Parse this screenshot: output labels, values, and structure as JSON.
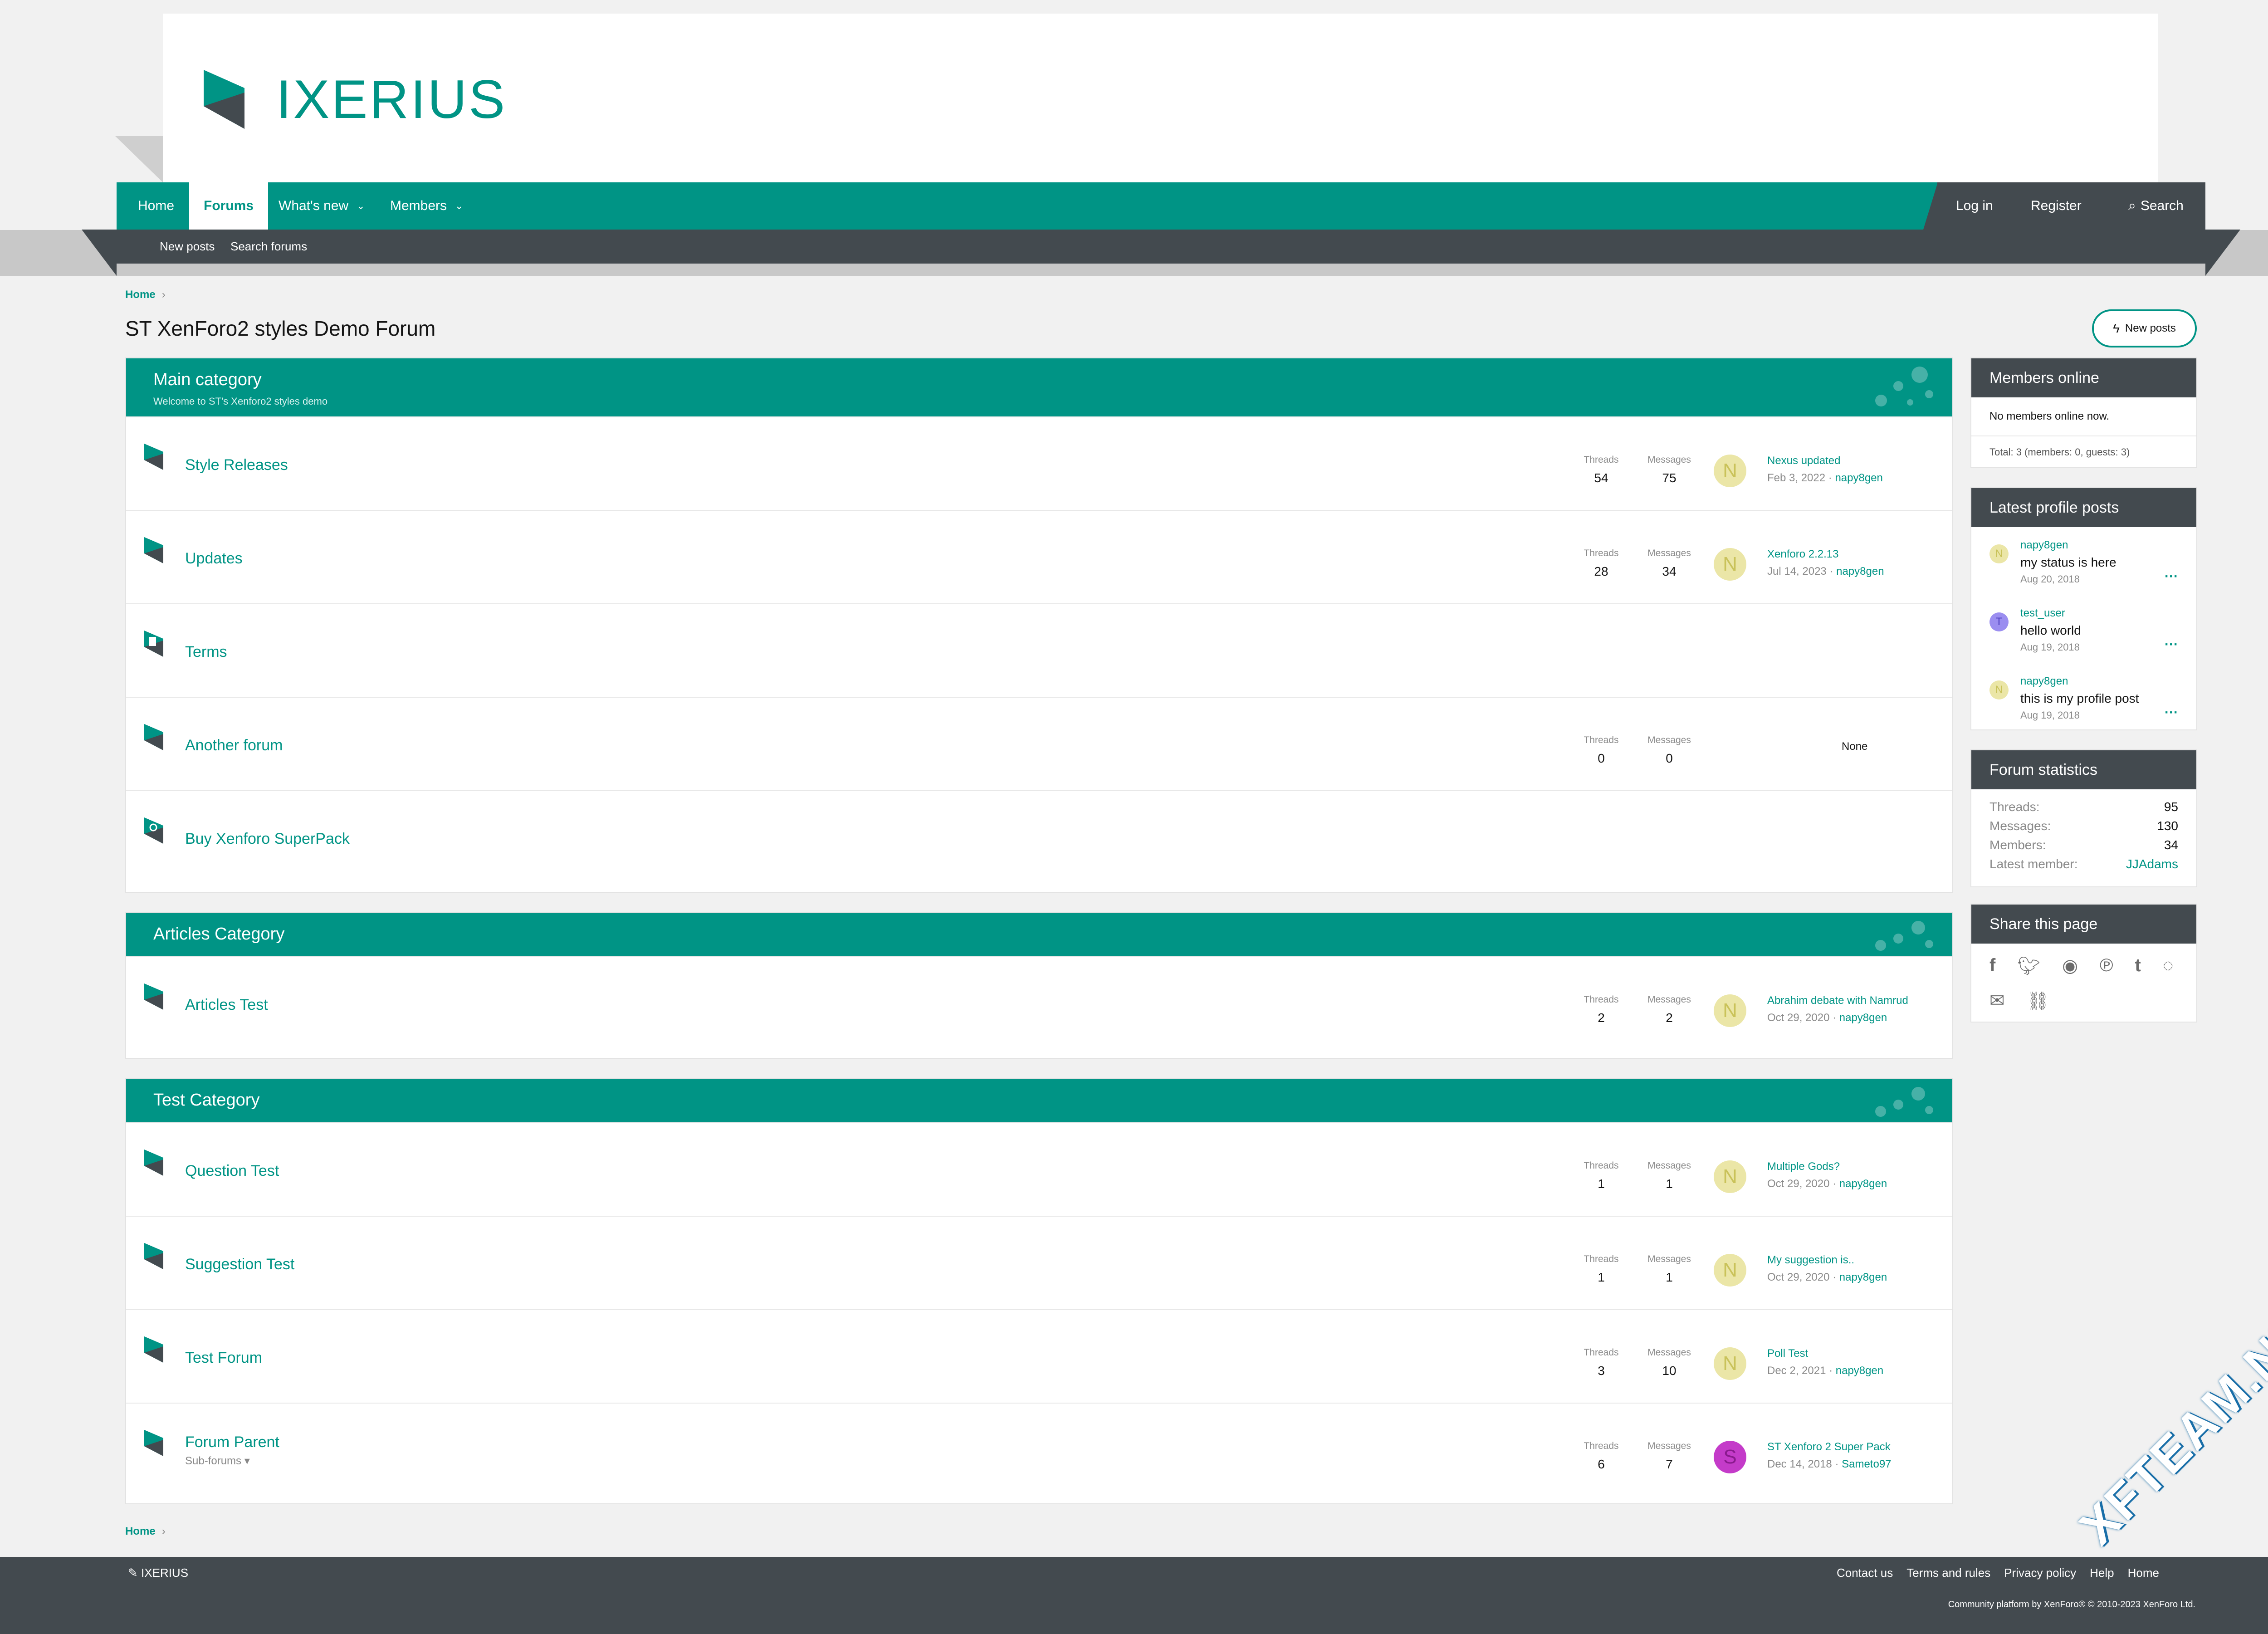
{
  "brand": {
    "name": "IXERIUS",
    "color": "#009485",
    "dark": "#434a4f"
  },
  "nav": {
    "items": [
      {
        "label": "Home"
      },
      {
        "label": "Forums",
        "active": true
      },
      {
        "label": "What's new"
      },
      {
        "label": "Members"
      }
    ],
    "login": "Log in",
    "register": "Register",
    "search": "Search",
    "subnav": [
      "New posts",
      "Search forums"
    ]
  },
  "breadcrumb": {
    "home": "Home"
  },
  "page": {
    "title": "ST XenForo2 styles Demo Forum",
    "new_posts_button": "New posts"
  },
  "labels": {
    "threads": "Threads",
    "messages": "Messages",
    "none": "None",
    "sub_forums": "Sub-forums"
  },
  "categories": [
    {
      "title": "Main category",
      "description": "Welcome to ST's Xenforo2 styles demo",
      "nodes": [
        {
          "title": "Style Releases",
          "threads": "54",
          "messages": "75",
          "avatar": "N",
          "last_title": "Nexus updated",
          "last_date": "Feb 3, 2022",
          "last_user": "napy8gen"
        },
        {
          "title": "Updates",
          "threads": "28",
          "messages": "34",
          "avatar": "N",
          "last_title": "Xenforo 2.2.13",
          "last_date": "Jul 14, 2023",
          "last_user": "napy8gen"
        },
        {
          "title": "Terms"
        },
        {
          "title": "Another forum",
          "threads": "0",
          "messages": "0"
        },
        {
          "title": "Buy Xenforo SuperPack"
        }
      ]
    },
    {
      "title": "Articles Category",
      "nodes": [
        {
          "title": "Articles Test",
          "threads": "2",
          "messages": "2",
          "avatar": "N",
          "last_title": "Abrahim debate with Namrud",
          "last_date": "Oct 29, 2020",
          "last_user": "napy8gen"
        }
      ]
    },
    {
      "title": "Test Category",
      "nodes": [
        {
          "title": "Question Test",
          "threads": "1",
          "messages": "1",
          "avatar": "N",
          "last_title": "Multiple Gods?",
          "last_date": "Oct 29, 2020",
          "last_user": "napy8gen"
        },
        {
          "title": "Suggestion Test",
          "threads": "1",
          "messages": "1",
          "avatar": "N",
          "last_title": "My suggestion is..",
          "last_date": "Oct 29, 2020",
          "last_user": "napy8gen"
        },
        {
          "title": "Test Forum",
          "threads": "3",
          "messages": "10",
          "avatar": "N",
          "last_title": "Poll Test",
          "last_date": "Dec 2, 2021",
          "last_user": "napy8gen"
        },
        {
          "title": "Forum Parent",
          "threads": "6",
          "messages": "7",
          "avatar": "S",
          "last_title": "ST Xenforo 2 Super Pack",
          "last_date": "Dec 14, 2018",
          "last_user": "Sameto97"
        }
      ]
    }
  ],
  "sidebar": {
    "members_online": {
      "title": "Members online",
      "body": "No members online now.",
      "total": "Total: 3 (members: 0, guests: 3)"
    },
    "profile_posts": {
      "title": "Latest profile posts",
      "items": [
        {
          "avatar": "N",
          "user": "napy8gen",
          "text": "my status is here",
          "date": "Aug 20, 2018"
        },
        {
          "avatar": "T",
          "user": "test_user",
          "text": "hello world",
          "date": "Aug 19, 2018"
        },
        {
          "avatar": "N",
          "user": "napy8gen",
          "text": "this is my profile post",
          "date": "Aug 19, 2018"
        }
      ]
    },
    "forum_stats": {
      "title": "Forum statistics",
      "threads_label": "Threads:",
      "threads": "95",
      "messages_label": "Messages:",
      "messages": "130",
      "members_label": "Members:",
      "members": "34",
      "latest_label": "Latest member:",
      "latest": "JJAdams"
    },
    "share": {
      "title": "Share this page",
      "icons": [
        "facebook-icon",
        "twitter-icon",
        "reddit-icon",
        "pinterest-icon",
        "tumblr-icon",
        "whatsapp-icon",
        "email-icon",
        "link-icon"
      ]
    }
  },
  "footer": {
    "brand": "IXERIUS",
    "links": [
      "Contact us",
      "Terms and rules",
      "Privacy policy",
      "Help",
      "Home"
    ],
    "copyright": "Community platform by XenForo® © 2010-2023 XenForo Ltd."
  },
  "watermark": "XFTEAM.NET"
}
